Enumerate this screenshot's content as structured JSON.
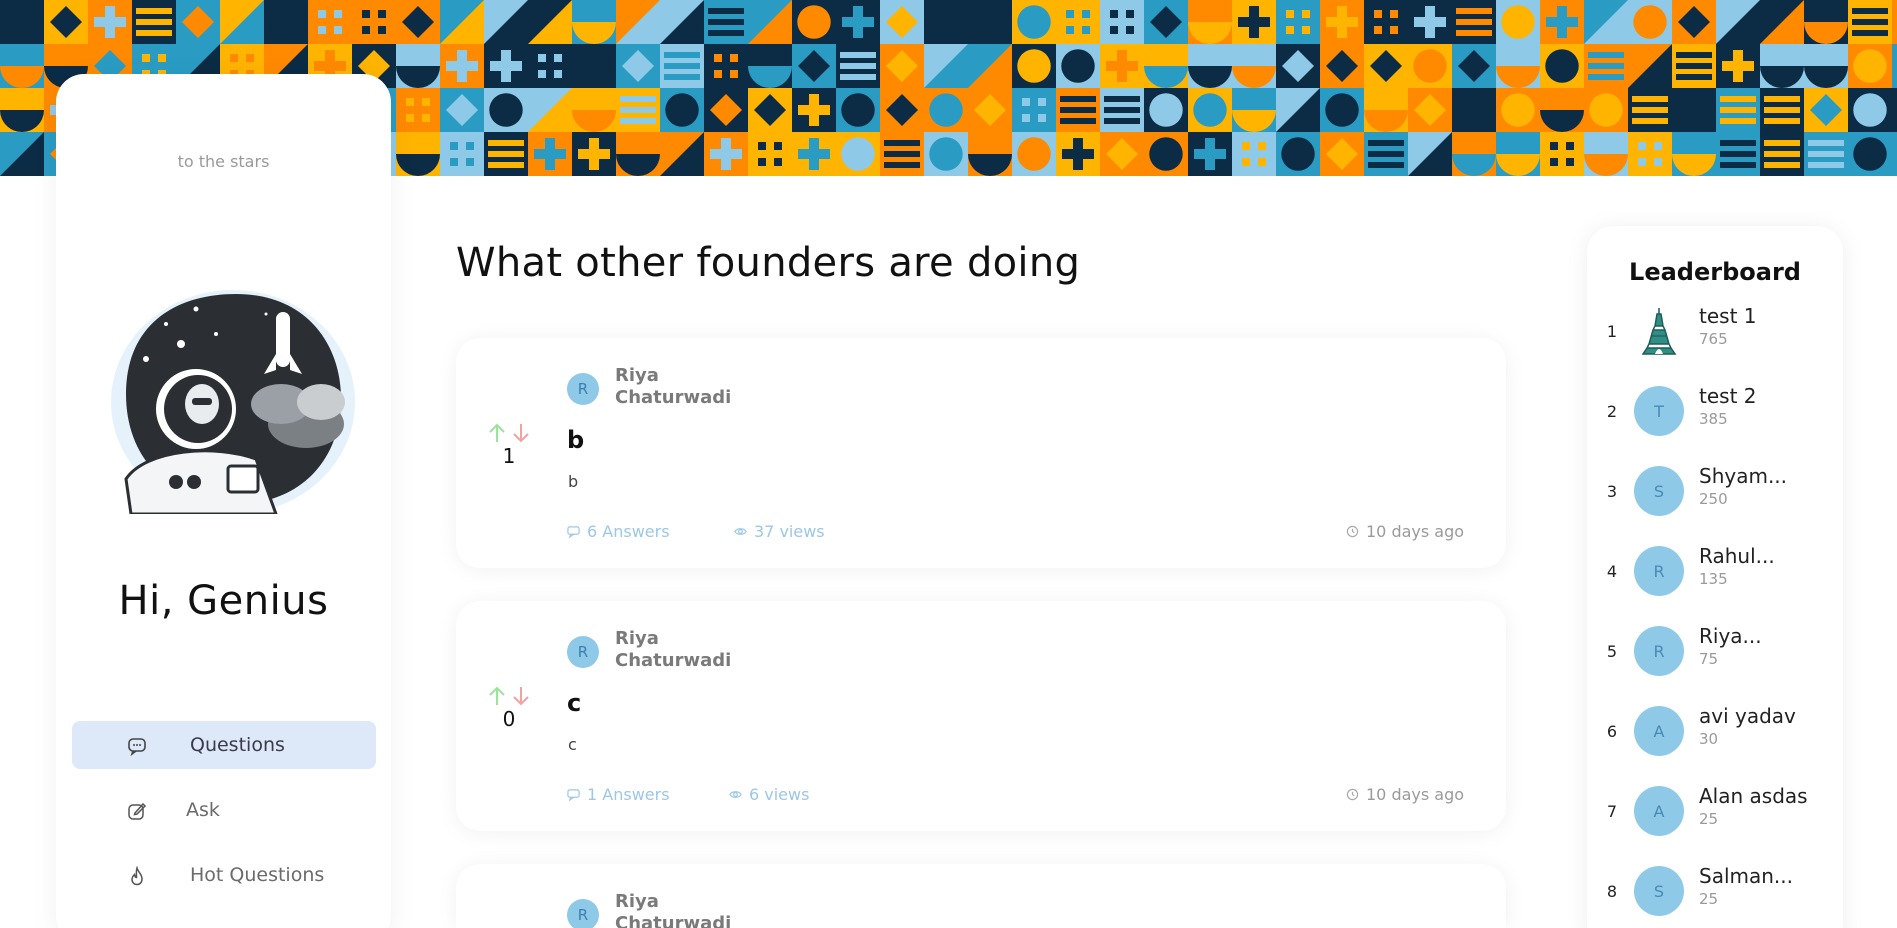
{
  "sidebar": {
    "tagline": "to the stars",
    "greeting": "Hi, Genius",
    "nav": [
      {
        "label": "Questions",
        "icon": "chat-icon",
        "active": true
      },
      {
        "label": "Ask",
        "icon": "edit-icon",
        "active": false
      },
      {
        "label": "Hot Questions",
        "icon": "flame-icon",
        "active": false
      }
    ]
  },
  "main": {
    "title": "What other founders are doing",
    "questions": [
      {
        "author_initial": "R",
        "author": "Riya Chaturwadi",
        "votes": "1",
        "title": "b",
        "body": "b",
        "answers": "6 Answers",
        "views": "37 views",
        "time": "10 days ago"
      },
      {
        "author_initial": "R",
        "author": "Riya Chaturwadi",
        "votes": "0",
        "title": "c",
        "body": "c",
        "answers": "1 Answers",
        "views": "6 views",
        "time": "10 days ago"
      },
      {
        "author_initial": "R",
        "author": "Riya Chaturwadi"
      }
    ]
  },
  "leaderboard": {
    "title": "Leaderboard",
    "entries": [
      {
        "rank": "1",
        "initial": "",
        "name": "test 1",
        "score": "765",
        "avatar": "eiffel-tower-icon"
      },
      {
        "rank": "2",
        "initial": "T",
        "name": "test 2",
        "score": "385"
      },
      {
        "rank": "3",
        "initial": "S",
        "name": "Shyam...",
        "score": "250"
      },
      {
        "rank": "4",
        "initial": "R",
        "name": "Rahul...",
        "score": "135"
      },
      {
        "rank": "5",
        "initial": "R",
        "name": "Riya...",
        "score": "75"
      },
      {
        "rank": "6",
        "initial": "A",
        "name": "avi yadav",
        "score": "30"
      },
      {
        "rank": "7",
        "initial": "A",
        "name": "Alan asdas",
        "score": "25"
      },
      {
        "rank": "8",
        "initial": "S",
        "name": "Salman...",
        "score": "25"
      }
    ]
  },
  "colors": {
    "banner_blue": "#8ec9e8",
    "banner_orange": "#ff8a00",
    "banner_yellow": "#ffb400",
    "banner_navy": "#0c2b44",
    "banner_teal": "#2a9cc4",
    "nav_active_bg": "#dde8f8",
    "upvote": "#9be39b",
    "downvote": "#f0a3a3",
    "meta_blue": "#9cc7e6"
  }
}
